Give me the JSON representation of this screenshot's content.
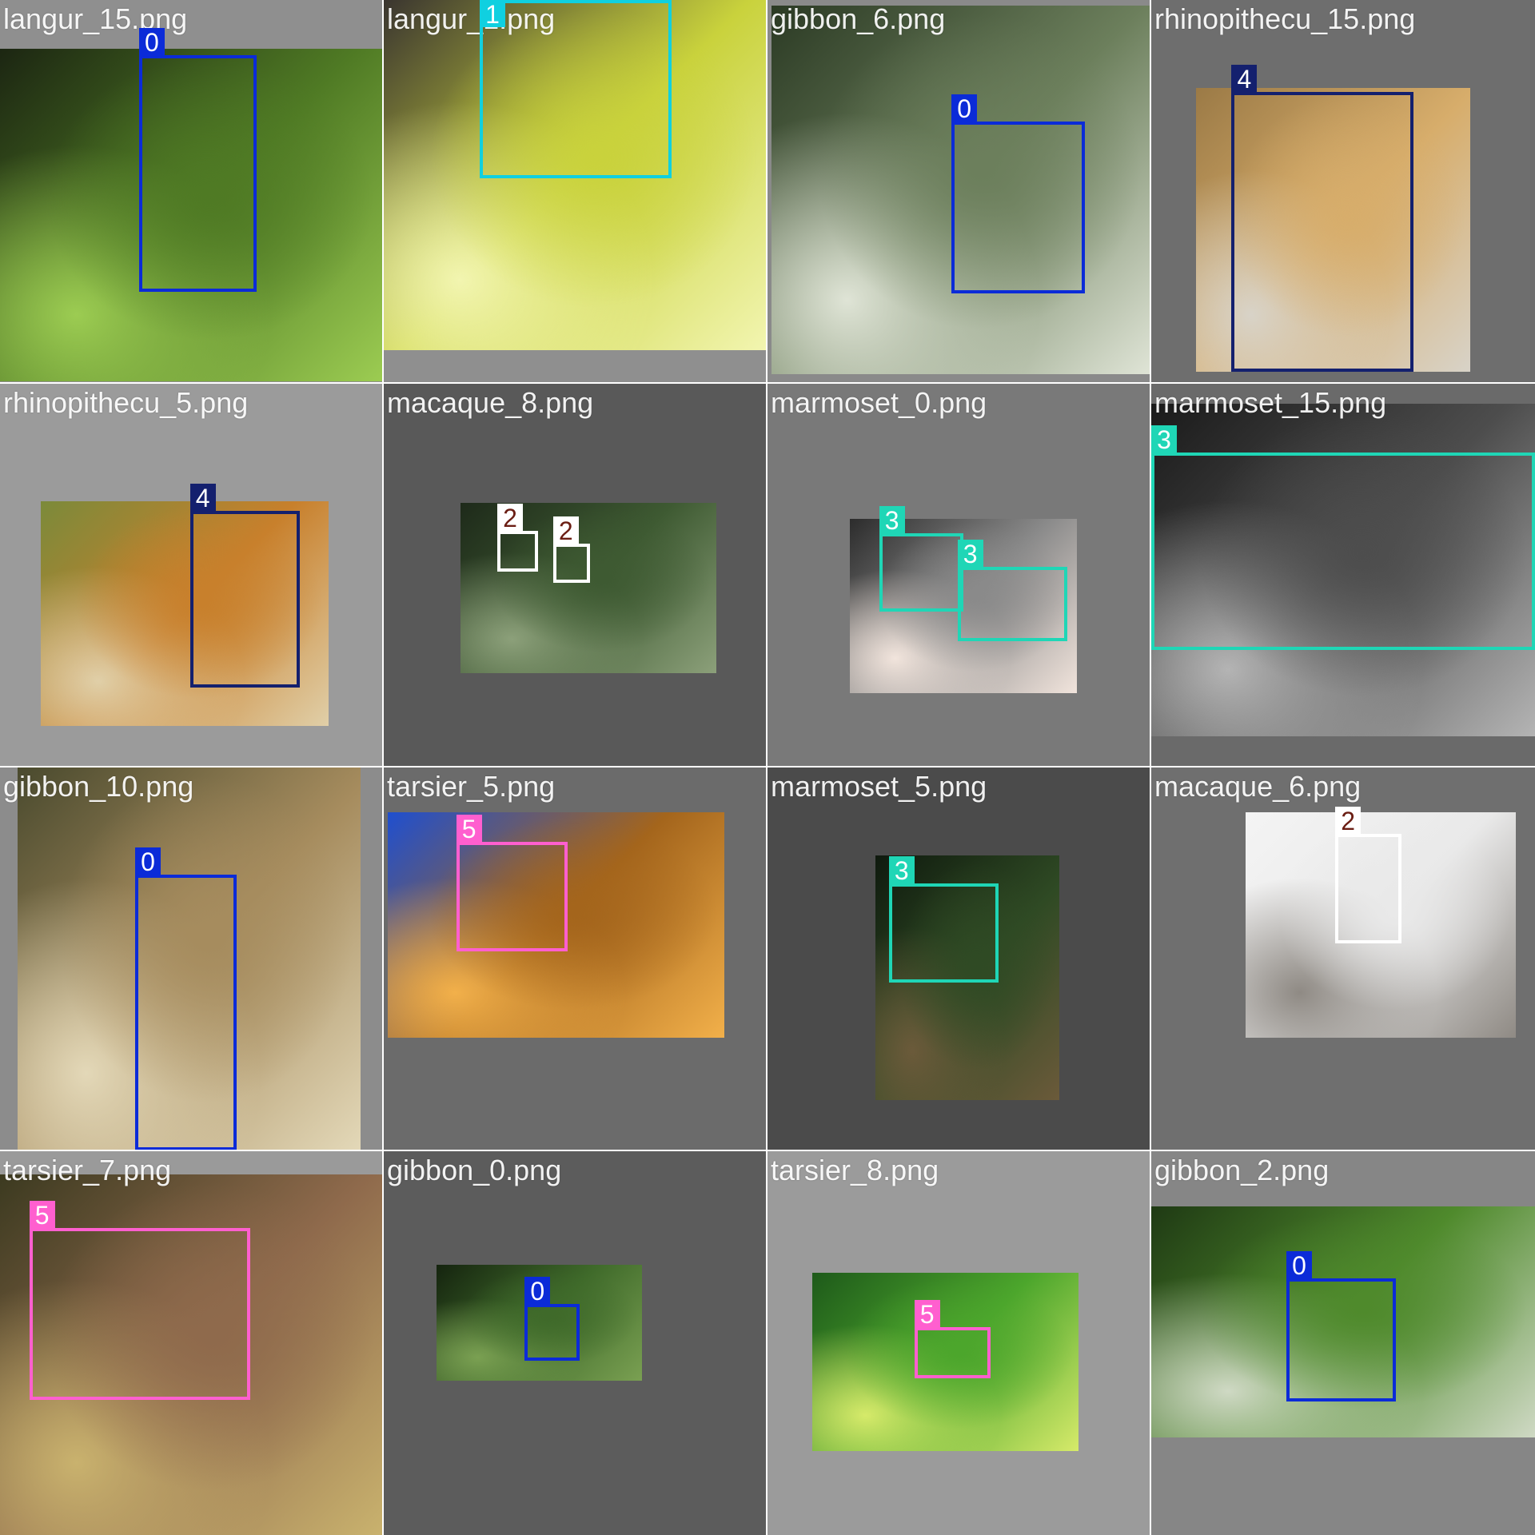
{
  "tiles": [
    {
      "label": "langur_15.png",
      "background": "#8f8f8f",
      "photo_colors": [
        "#1c2612",
        "#4f7a24",
        "#9ccc52"
      ],
      "boxes": [
        {
          "cls": "0"
        }
      ]
    },
    {
      "label": "langur_1.png",
      "background": "#8f8f8f",
      "photo_colors": [
        "#3a3530",
        "#c9d23c",
        "#f2f5b0"
      ],
      "boxes": [
        {
          "cls": "1"
        }
      ]
    },
    {
      "label": "gibbon_6.png",
      "background": "#8a8a8a",
      "photo_colors": [
        "#2b3a24",
        "#6c7f5c",
        "#dfe4d6"
      ],
      "boxes": [
        {
          "cls": "0"
        }
      ]
    },
    {
      "label": "rhinopithecu_15.png",
      "background": "#6e6e6e",
      "photo_colors": [
        "#9b7a46",
        "#d7ad6b",
        "#d8d3c8"
      ],
      "boxes": [
        {
          "cls": "4"
        }
      ]
    },
    {
      "label": "rhinopithecu_5.png",
      "background": "#9b9b9b",
      "photo_colors": [
        "#7b8a3a",
        "#c8802c",
        "#e0cfa8"
      ],
      "boxes": [
        {
          "cls": "4"
        }
      ]
    },
    {
      "label": "macaque_8.png",
      "background": "#595959",
      "photo_colors": [
        "#1e2a1a",
        "#3e5a32",
        "#8ca07a"
      ],
      "boxes": [
        {
          "cls": "2"
        },
        {
          "cls": "2"
        }
      ]
    },
    {
      "label": "marmoset_0.png",
      "background": "#797979",
      "photo_colors": [
        "#2c2c2c",
        "#8a8a8a",
        "#f1e4dc"
      ],
      "boxes": [
        {
          "cls": "3"
        },
        {
          "cls": "3"
        }
      ]
    },
    {
      "label": "marmoset_15.png",
      "background": "#6a6a6a",
      "photo_colors": [
        "#1a1a1a",
        "#4d4d4d",
        "#b4b4b4"
      ],
      "boxes": [
        {
          "cls": "3"
        }
      ]
    },
    {
      "label": "gibbon_10.png",
      "background": "#8c8c8c",
      "photo_colors": [
        "#4a4a2e",
        "#a68c5e",
        "#e3d8b8"
      ],
      "boxes": [
        {
          "cls": "0"
        }
      ]
    },
    {
      "label": "tarsier_5.png",
      "background": "#6b6b6b",
      "photo_colors": [
        "#1f4fcf",
        "#a4651c",
        "#f2b04a"
      ],
      "boxes": [
        {
          "cls": "5"
        }
      ]
    },
    {
      "label": "marmoset_5.png",
      "background": "#4b4b4b",
      "photo_colors": [
        "#0f1a0e",
        "#2f4a24",
        "#6b5a3a"
      ],
      "boxes": [
        {
          "cls": "3"
        }
      ]
    },
    {
      "label": "macaque_6.png",
      "background": "#6f6f6f",
      "photo_colors": [
        "#f4f4f4",
        "#e9e9e9",
        "#8f8a84"
      ],
      "boxes": [
        {
          "cls": "2"
        }
      ]
    },
    {
      "label": "tarsier_7.png",
      "background": "#9a9a9a",
      "photo_colors": [
        "#3c3a20",
        "#8f6a4c",
        "#c9b26e"
      ],
      "boxes": [
        {
          "cls": "5"
        }
      ]
    },
    {
      "label": "gibbon_0.png",
      "background": "#5c5c5c",
      "photo_colors": [
        "#15240f",
        "#3f6a2a",
        "#7aa052"
      ],
      "boxes": [
        {
          "cls": "0"
        }
      ]
    },
    {
      "label": "tarsier_8.png",
      "background": "#9b9b9b",
      "photo_colors": [
        "#1e5a1a",
        "#4ca62c",
        "#d6ea6a"
      ],
      "boxes": [
        {
          "cls": "5"
        }
      ]
    },
    {
      "label": "gibbon_2.png",
      "background": "#868686",
      "photo_colors": [
        "#1f3a14",
        "#4f8a2c",
        "#cfd9c4"
      ],
      "boxes": [
        {
          "cls": "0"
        }
      ]
    }
  ],
  "class_colors": {
    "0": {
      "border": "#0b2bd8",
      "tag_bg": "#0b2bd8",
      "tag_fg": "#ffffff"
    },
    "1": {
      "border": "#10d0e0",
      "tag_bg": "#10d0e0",
      "tag_fg": "#ffffff"
    },
    "2": {
      "border": "#ffffff",
      "tag_bg": "#ffffff",
      "tag_fg": "#6b1e14"
    },
    "3": {
      "border": "#1fd6b6",
      "tag_bg": "#1fd6b6",
      "tag_fg": "#ffffff"
    },
    "4": {
      "border": "#14206e",
      "tag_bg": "#14206e",
      "tag_fg": "#ffffff"
    },
    "5": {
      "border": "#ff5fcf",
      "tag_bg": "#ff5fcf",
      "tag_fg": "#ffffff"
    }
  }
}
